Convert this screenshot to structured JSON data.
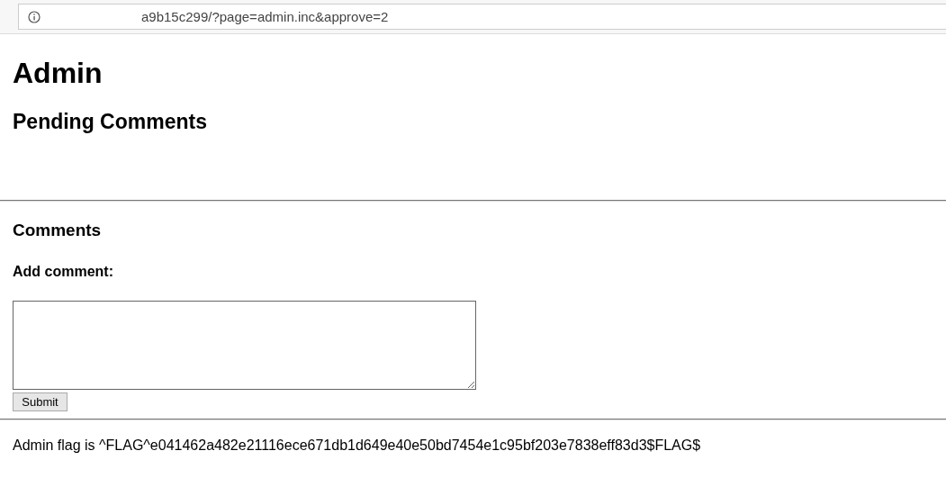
{
  "address_bar": {
    "url": "a9b15c299/?page=admin.inc&approve=2"
  },
  "page": {
    "title": "Admin",
    "pending_heading": "Pending Comments",
    "comments_heading": "Comments",
    "add_comment_label": "Add comment:",
    "submit_button": "Submit",
    "flag_text": "Admin flag is ^FLAG^e041462a482e21116ece671db1d649e40e50bd7454e1c95bf203e7838eff83d3$FLAG$"
  }
}
